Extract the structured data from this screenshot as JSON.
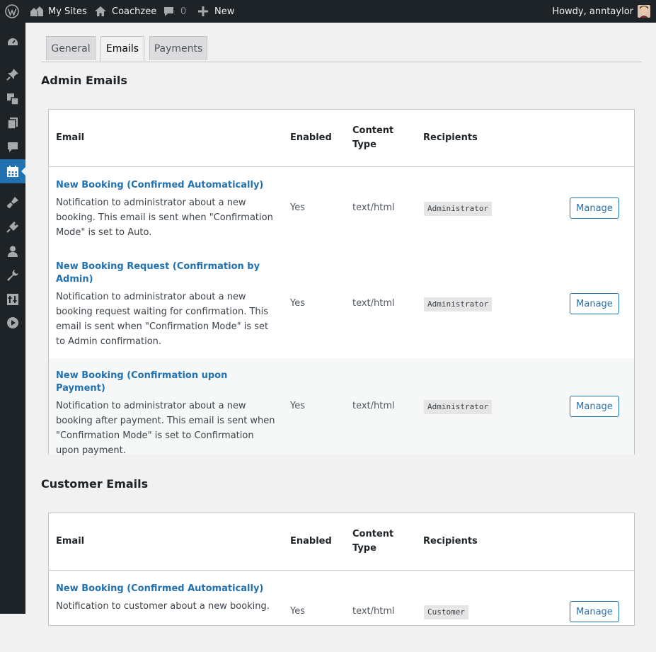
{
  "adminbar": {
    "my_sites": "My Sites",
    "site_name": "Coachzee",
    "comments_count": "0",
    "new_label": "New",
    "howdy": "Howdy, anntaylor"
  },
  "sidebar": {
    "icons": [
      "dashboard-icon",
      "pin-icon",
      "media-icon",
      "pages-icon",
      "comments-icon",
      "calendar-icon",
      "appearance-icon",
      "plugins-icon",
      "users-icon",
      "tools-icon",
      "settings-icon",
      "play-icon"
    ],
    "active": "calendar-icon"
  },
  "tabs": [
    {
      "label": "General"
    },
    {
      "label": "Emails"
    },
    {
      "label": "Payments"
    }
  ],
  "active_tab": "Emails",
  "admin_emails": {
    "title": "Admin Emails",
    "columns": {
      "email": "Email",
      "enabled": "Enabled",
      "content_type_1": "Content",
      "content_type_2": "Type",
      "recipients": "Recipients"
    },
    "rows": [
      {
        "title": "New Booking (Confirmed Automatically)",
        "desc": "Notification to administrator about a new booking. This email is sent when \"Confirmation Mode\" is set to Auto.",
        "enabled": "Yes",
        "content_type": "text/html",
        "recipient": "Administrator",
        "action": "Manage"
      },
      {
        "title": "New Booking Request (Confirmation by Admin)",
        "desc": "Notification to administrator about a new booking request waiting for confirmation. This email is sent when \"Confirmation Mode\" is set to Admin confirmation.",
        "enabled": "Yes",
        "content_type": "text/html",
        "recipient": "Administrator",
        "action": "Manage"
      },
      {
        "title": "New Booking (Confirmation upon Payment)",
        "desc": "Notification to administrator about a new booking after payment. This email is sent when \"Confirmation Mode\" is set to Confirmation upon payment.",
        "enabled": "Yes",
        "content_type": "text/html",
        "recipient": "Administrator",
        "action": "Manage"
      }
    ]
  },
  "customer_emails": {
    "title": "Customer Emails",
    "columns": {
      "email": "Email",
      "enabled": "Enabled",
      "content_type_1": "Content",
      "content_type_2": "Type",
      "recipients": "Recipients"
    },
    "rows": [
      {
        "title": "New Booking (Confirmed Automatically)",
        "desc": "Notification to customer about a new booking.",
        "enabled": "Yes",
        "content_type": "text/html",
        "recipient": "Customer",
        "action": "Manage"
      }
    ]
  },
  "colors": {
    "admin_bar": "#1d2327",
    "accent": "#2271b1",
    "background": "#f1f1f1"
  }
}
